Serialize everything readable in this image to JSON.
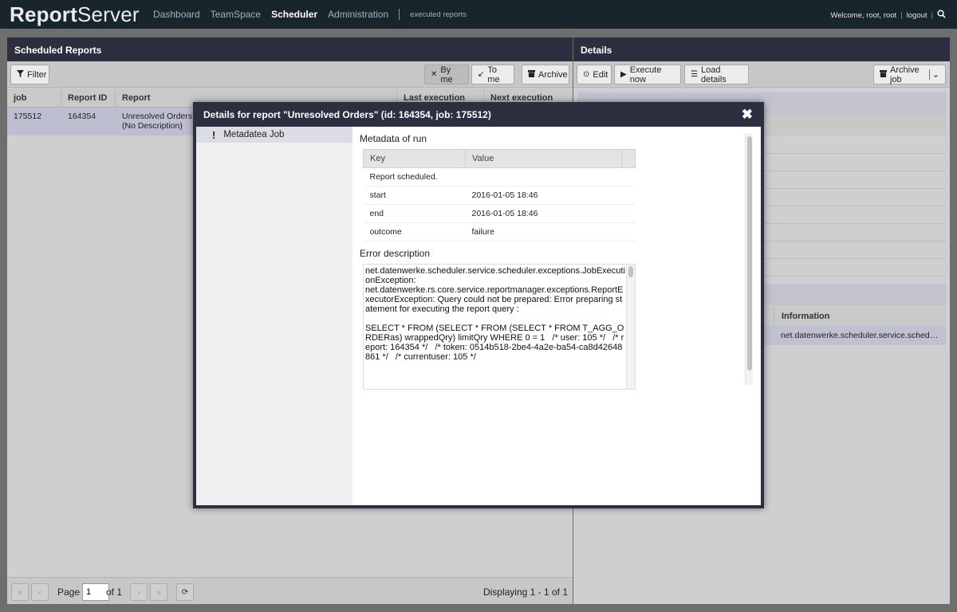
{
  "app": {
    "logo_bold": "Report",
    "logo_rest": "Server"
  },
  "nav": {
    "items": [
      "Dashboard",
      "TeamSpace",
      "Scheduler",
      "Administration"
    ],
    "active": "Scheduler",
    "breadcrumb": "executed reports"
  },
  "user": {
    "welcome": "Welcome, root, root",
    "logout": "logout"
  },
  "left_panel": {
    "title": "Scheduled Reports",
    "filter": "Filter",
    "by_me": "By me",
    "to_me": "To me",
    "archive": "Archive",
    "columns": [
      "job",
      "Report ID",
      "Report",
      "Last execution",
      "Next execution"
    ],
    "rows": [
      {
        "job": "175512",
        "report_id": "164354",
        "report": "Unresolved Orders",
        "report_desc": "(No Description)"
      }
    ]
  },
  "pager": {
    "page_label": "Page",
    "page_value": "1",
    "of_label": "of 1",
    "displaying": "Displaying 1 - 1 of 1"
  },
  "right_panel": {
    "title": "Details",
    "edit": "Edit",
    "execute_now": "Execute now",
    "load_details": "Load details",
    "archive_job": "Archive job",
    "info_column": "Information",
    "info_value": "net.datenwerke.scheduler.service.sched…"
  },
  "modal": {
    "title": "Details for report \"Unresolved Orders\" (id: 164354, job: 175512)",
    "nav_item": "Metadatea Job",
    "metadata_label": "Metadata of run",
    "key_header": "Key",
    "value_header": "Value",
    "rows": [
      {
        "key": "Report scheduled.",
        "value": ""
      },
      {
        "key": "start",
        "value": "2016-01-05 18:46"
      },
      {
        "key": "end",
        "value": "2016-01-05 18:46"
      },
      {
        "key": "outcome",
        "value": "failure"
      }
    ],
    "error_label": "Error description",
    "error_text": "net.datenwerke.scheduler.service.scheduler.exceptions.JobExecutionException:\nnet.datenwerke.rs.core.service.reportmanager.exceptions.ReportExecutorException: Query could not be prepared: Error preparing statement for executing the report query :\n\nSELECT * FROM (SELECT * FROM (SELECT * FROM T_AGG_ORDERas) wrappedQry) limitQry WHERE 0 = 1   /* user: 105 */   /* report: 164354 */   /* token: 0514b518-2be4-4a2e-ba54-ca8d42648861 */   /* currentuser: 105 */\n\n\n\n        at"
  },
  "icons": {
    "filter": "funnel-icon",
    "by_me": "arrows-icon",
    "archive": "box-icon",
    "edit": "edit-icon",
    "execute": "play-icon",
    "load": "list-icon",
    "search": "search-icon",
    "close": "close-icon"
  }
}
